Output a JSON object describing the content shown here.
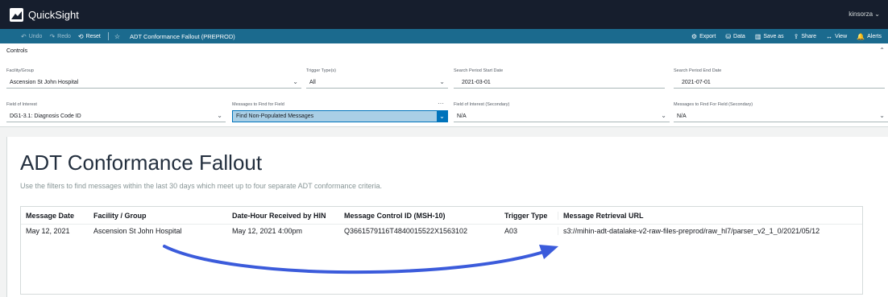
{
  "app": {
    "name": "QuickSight",
    "user": "kinsorza"
  },
  "toolbar": {
    "undo_label": "Undo",
    "redo_label": "Redo",
    "reset_label": "Reset",
    "analysis_title": "ADT Conformance Fallout (PREPROD)",
    "export_label": "Export",
    "data_label": "Data",
    "save_as_label": "Save as",
    "share_label": "Share",
    "view_label": "View",
    "alerts_label": "Alerts"
  },
  "controls": {
    "title": "Controls",
    "facility": {
      "label": "Facility/Group",
      "value": "Ascension St John Hospital"
    },
    "trigger": {
      "label": "Trigger Type(s)",
      "value": "All"
    },
    "start_date": {
      "label": "Search Period Start Date",
      "value": "2021-03-01"
    },
    "end_date": {
      "label": "Search Period End Date",
      "value": "2021-07-01"
    },
    "field_interest": {
      "label": "Field of Interest",
      "value": "DG1-3.1: Diagnosis Code ID"
    },
    "messages_find": {
      "label": "Messages to Find for Field",
      "value": "Find Non-Populated Messages"
    },
    "field_interest_secondary": {
      "label": "Field of Interest (Secondary)",
      "value": "N/A"
    },
    "messages_find_secondary": {
      "label": "Messages to Find For Field (Secondary)",
      "value": "N/A"
    }
  },
  "sheet": {
    "title": "ADT Conformance Fallout",
    "subtitle": "Use the filters to find messages within the last 30 days which meet up to four separate ADT conformance criteria."
  },
  "table": {
    "headers": [
      "Message Date",
      "Facility / Group",
      "Date-Hour Received by HIN",
      "Message Control ID (MSH-10)",
      "Trigger Type",
      "Message Retrieval URL"
    ],
    "rows": [
      [
        "May 12, 2021",
        "Ascension St John Hospital",
        "May 12, 2021 4:00pm",
        "Q3661579116T4840015522X1563102",
        "A03",
        "s3://mihin-adt-datalake-v2-raw-files-preprod/raw_hl7/parser_v2_1_0/2021/05/12"
      ]
    ]
  },
  "colors": {
    "topbar": "#161e2d",
    "toolbar": "#1b6a8e",
    "highlight": "#a9cfe6",
    "arrow": "#3b5bdb"
  }
}
